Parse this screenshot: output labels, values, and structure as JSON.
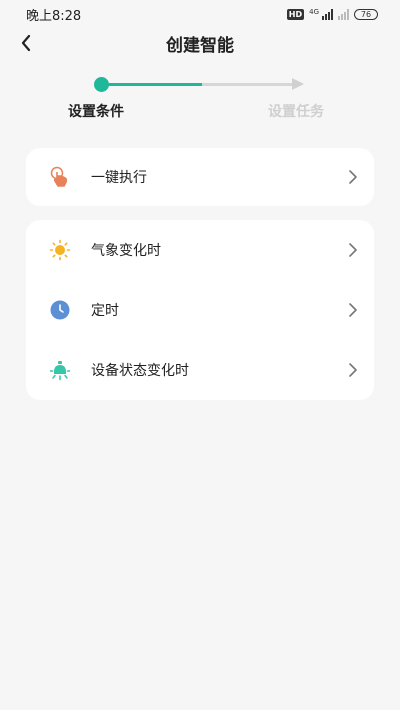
{
  "status_bar": {
    "time": "晚上8:28",
    "hd": "HD",
    "network": "4G",
    "battery": "76"
  },
  "header": {
    "title": "创建智能",
    "back_icon": "chevron-left-icon"
  },
  "stepper": {
    "steps": [
      {
        "label": "设置条件",
        "active": true
      },
      {
        "label": "设置任务",
        "active": false
      }
    ],
    "active_color": "#1fb89a",
    "inactive_color": "#d0d0d0"
  },
  "cards": [
    {
      "items": [
        {
          "label": "一键执行",
          "icon": "tap-hand-icon",
          "icon_color": "#e8825a"
        }
      ]
    },
    {
      "items": [
        {
          "label": "气象变化时",
          "icon": "sun-icon",
          "icon_color": "#f5b323"
        },
        {
          "label": "定时",
          "icon": "clock-icon",
          "icon_color": "#5b8fd6"
        },
        {
          "label": "设备状态变化时",
          "icon": "light-bulb-icon",
          "icon_color": "#35c7a8"
        }
      ]
    }
  ]
}
